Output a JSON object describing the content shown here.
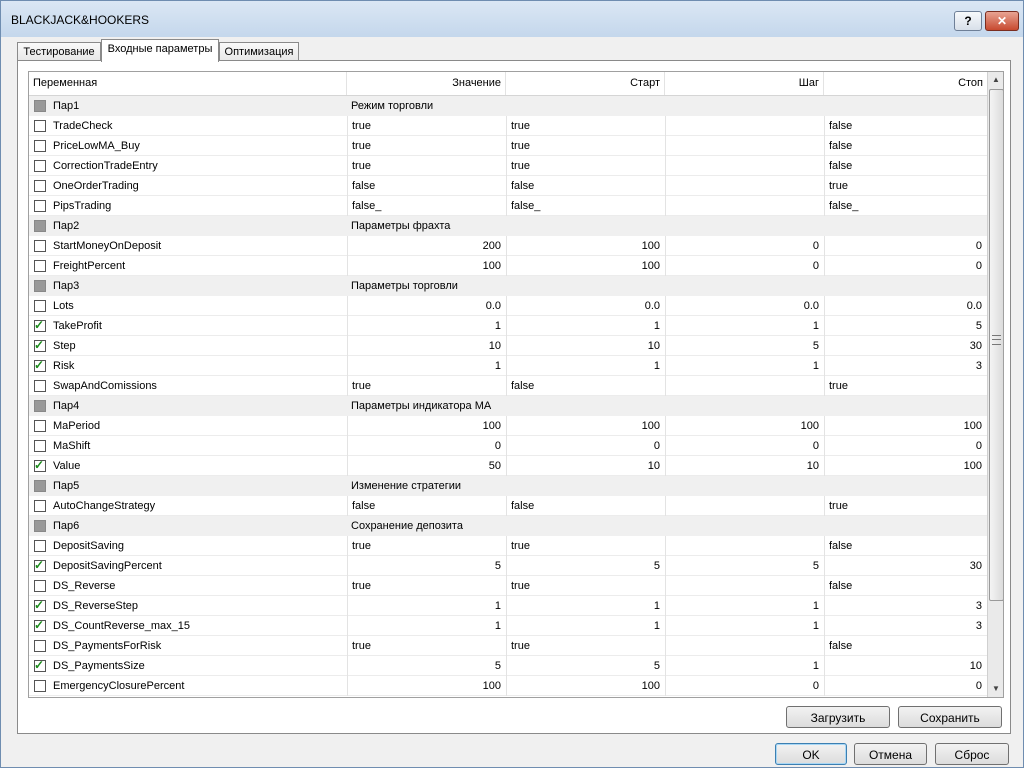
{
  "window": {
    "title": "BLACKJACK&HOOKERS",
    "help_label": "?",
    "close_label": "✕"
  },
  "tabs": [
    {
      "label": "Тестирование"
    },
    {
      "label": "Входные параметры",
      "active": true
    },
    {
      "label": "Оптимизация"
    }
  ],
  "grid": {
    "columns": [
      "Переменная",
      "Значение",
      "Старт",
      "Шаг",
      "Стоп"
    ],
    "rows": [
      {
        "name": "Пар1",
        "value": "Режим торговли",
        "start": "",
        "step": "",
        "stop": "",
        "group": true,
        "checked": false
      },
      {
        "name": "TradeCheck",
        "value": "true",
        "start": "true",
        "step": "",
        "stop": "false",
        "group": false,
        "checked": false
      },
      {
        "name": "PriceLowMA_Buy",
        "value": "true",
        "start": "true",
        "step": "",
        "stop": "false",
        "group": false,
        "checked": false
      },
      {
        "name": "CorrectionTradeEntry",
        "value": "true",
        "start": "true",
        "step": "",
        "stop": "false",
        "group": false,
        "checked": false
      },
      {
        "name": "OneOrderTrading",
        "value": "false",
        "start": "false",
        "step": "",
        "stop": "true",
        "group": false,
        "checked": false
      },
      {
        "name": "PipsTrading",
        "value": "false_",
        "start": "false_",
        "step": "",
        "stop": "false_",
        "group": false,
        "checked": false
      },
      {
        "name": "Пар2",
        "value": "Параметры фрахта",
        "start": "",
        "step": "",
        "stop": "",
        "group": true,
        "checked": false
      },
      {
        "name": "StartMoneyOnDeposit",
        "value": "200",
        "start": "100",
        "step": "0",
        "stop": "0",
        "group": false,
        "checked": false,
        "numeric": true
      },
      {
        "name": "FreightPercent",
        "value": "100",
        "start": "100",
        "step": "0",
        "stop": "0",
        "group": false,
        "checked": false,
        "numeric": true
      },
      {
        "name": "Пар3",
        "value": "Параметры торговли",
        "start": "",
        "step": "",
        "stop": "",
        "group": true,
        "checked": false
      },
      {
        "name": "Lots",
        "value": "0.0",
        "start": "0.0",
        "step": "0.0",
        "stop": "0.0",
        "group": false,
        "checked": false,
        "numeric": true
      },
      {
        "name": "TakeProfit",
        "value": "1",
        "start": "1",
        "step": "1",
        "stop": "5",
        "group": false,
        "checked": true,
        "numeric": true
      },
      {
        "name": "Step",
        "value": "10",
        "start": "10",
        "step": "5",
        "stop": "30",
        "group": false,
        "checked": true,
        "numeric": true
      },
      {
        "name": "Risk",
        "value": "1",
        "start": "1",
        "step": "1",
        "stop": "3",
        "group": false,
        "checked": true,
        "numeric": true
      },
      {
        "name": "SwapAndComissions",
        "value": "true",
        "start": "false",
        "step": "",
        "stop": "true",
        "group": false,
        "checked": false
      },
      {
        "name": "Пар4",
        "value": "Параметры индикатора МА",
        "start": "",
        "step": "",
        "stop": "",
        "group": true,
        "checked": false
      },
      {
        "name": "MaPeriod",
        "value": "100",
        "start": "100",
        "step": "100",
        "stop": "100",
        "group": false,
        "checked": false,
        "numeric": true
      },
      {
        "name": "MaShift",
        "value": "0",
        "start": "0",
        "step": "0",
        "stop": "0",
        "group": false,
        "checked": false,
        "numeric": true
      },
      {
        "name": "Value",
        "value": "50",
        "start": "10",
        "step": "10",
        "stop": "100",
        "group": false,
        "checked": true,
        "numeric": true
      },
      {
        "name": "Пар5",
        "value": "Изменение стратегии",
        "start": "",
        "step": "",
        "stop": "",
        "group": true,
        "checked": false
      },
      {
        "name": "AutoChangeStrategy",
        "value": "false",
        "start": "false",
        "step": "",
        "stop": "true",
        "group": false,
        "checked": false
      },
      {
        "name": "Пар6",
        "value": "Сохранение депозита",
        "start": "",
        "step": "",
        "stop": "",
        "group": true,
        "checked": false
      },
      {
        "name": "DepositSaving",
        "value": "true",
        "start": "true",
        "step": "",
        "stop": "false",
        "group": false,
        "checked": false
      },
      {
        "name": "DepositSavingPercent",
        "value": "5",
        "start": "5",
        "step": "5",
        "stop": "30",
        "group": false,
        "checked": true,
        "numeric": true
      },
      {
        "name": "DS_Reverse",
        "value": "true",
        "start": "true",
        "step": "",
        "stop": "false",
        "group": false,
        "checked": false
      },
      {
        "name": "DS_ReverseStep",
        "value": "1",
        "start": "1",
        "step": "1",
        "stop": "3",
        "group": false,
        "checked": true,
        "numeric": true
      },
      {
        "name": "DS_CountReverse_max_15",
        "value": "1",
        "start": "1",
        "step": "1",
        "stop": "3",
        "group": false,
        "checked": true,
        "numeric": true
      },
      {
        "name": "DS_PaymentsForRisk",
        "value": "true",
        "start": "true",
        "step": "",
        "stop": "false",
        "group": false,
        "checked": false
      },
      {
        "name": "DS_PaymentsSize",
        "value": "5",
        "start": "5",
        "step": "1",
        "stop": "10",
        "group": false,
        "checked": true,
        "numeric": true
      },
      {
        "name": "EmergencyClosurePercent",
        "value": "100",
        "start": "100",
        "step": "0",
        "stop": "0",
        "group": false,
        "checked": false,
        "numeric": true
      }
    ]
  },
  "scrollbar": {
    "up_arrow": "▲",
    "down_arrow": "▼"
  },
  "panel_buttons": {
    "load": "Загрузить",
    "save": "Сохранить"
  },
  "dialog_buttons": {
    "ok": "OK",
    "cancel": "Отмена",
    "reset": "Сброс"
  }
}
